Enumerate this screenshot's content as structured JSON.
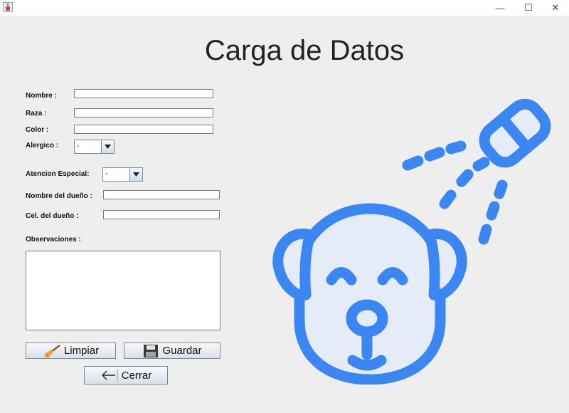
{
  "window": {
    "minimize": "—",
    "maximize": "☐",
    "close": "✕"
  },
  "title": "Carga de Datos",
  "form": {
    "nombre_label": "Nombre :",
    "raza_label": "Raza :",
    "color_label": "Color :",
    "alergico_label": "Alergico :",
    "alergico_value": "-",
    "atencion_label": "Atencion Especial:",
    "atencion_value": "-",
    "nombre_dueno_label": "Nombre del dueño :",
    "cel_dueno_label": "Cel. del dueño :",
    "observaciones_label": "Observaciones :"
  },
  "buttons": {
    "limpiar": "Limpiar",
    "guardar": "Guardar",
    "cerrar": "Cerrar"
  },
  "icons": {
    "app": "java-cup-icon",
    "limpiar": "broom-icon",
    "guardar": "floppy-disk-icon",
    "cerrar": "arrow-left-icon",
    "illustration": "dog-shower-icon"
  },
  "colors": {
    "illustration_stroke": "#3a86f2",
    "illustration_fill": "#e6ecf7"
  }
}
